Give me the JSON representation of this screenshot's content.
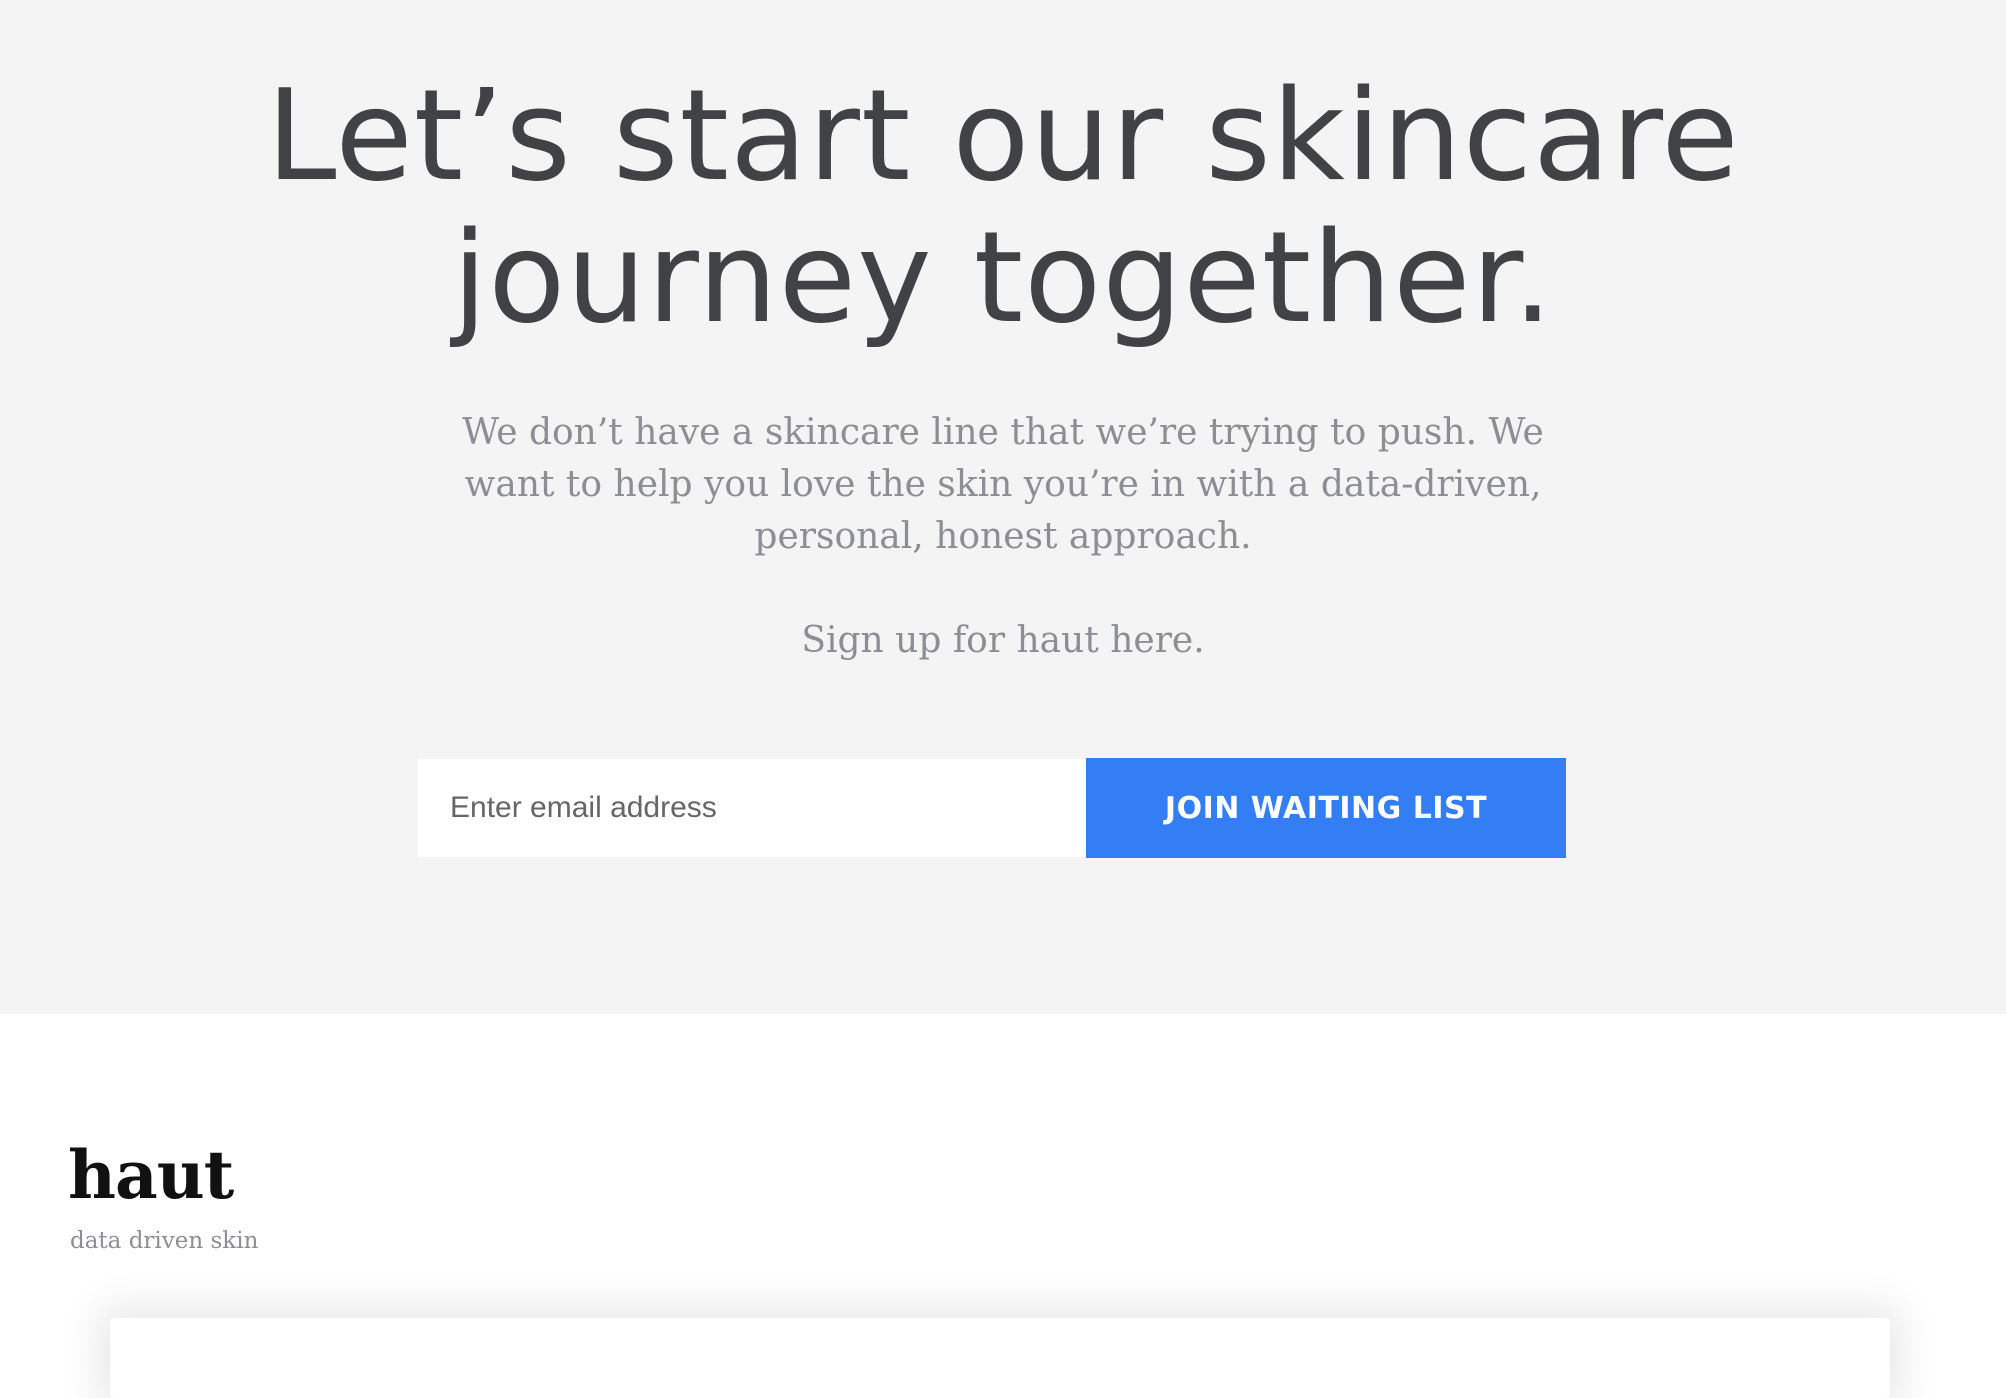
{
  "hero": {
    "title_line1": "Let’s start our skincare",
    "title_line2": "journey together.",
    "description": "We don’t have a skincare line that we’re trying to push. We want to help you love the skin you’re in with a data-driven, personal, honest approach.",
    "signup_prompt": "Sign up for haut here."
  },
  "signup_form": {
    "email_placeholder": "Enter email address",
    "email_value": "",
    "submit_label": "JOIN WAITING LIST"
  },
  "footer": {
    "brand_name": "haut",
    "tagline": "data driven skin"
  },
  "colors": {
    "hero_background": "#f4f4f4",
    "heading_text": "#414246",
    "body_text": "#8d8e93",
    "accent_button": "#347ef5",
    "page_background": "#ffffff"
  }
}
